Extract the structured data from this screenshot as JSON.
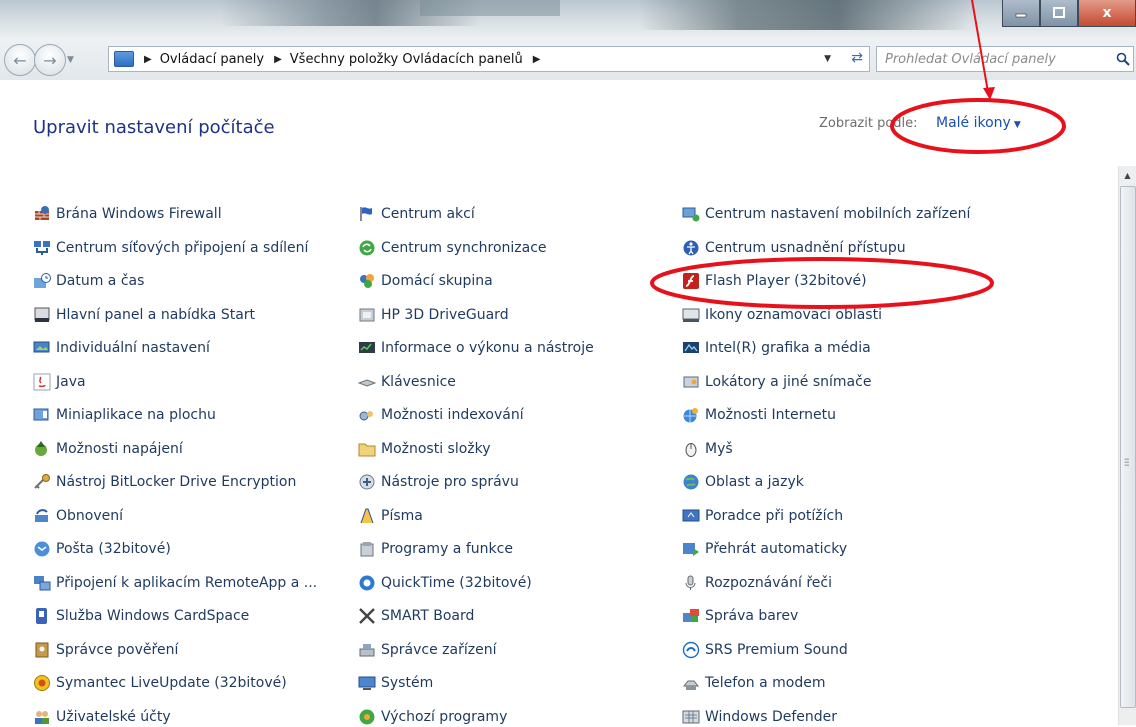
{
  "colors": {
    "link": "#1e3a5f",
    "title": "#1e3287",
    "annotation": "#e8101a"
  },
  "window": {
    "buttons": [
      "minimize-icon",
      "maximize-icon",
      "close-icon"
    ],
    "close_glyph": "x"
  },
  "address": {
    "crumbs": [
      "Ovládací panely",
      "Všechny položky Ovládacích panelů"
    ],
    "search_placeholder": "Prohledat Ovládací panely"
  },
  "header": {
    "title": "Upravit nastavení počítače",
    "view_by_label": "Zobrazit podle:",
    "view_by_value": "Malé ikony"
  },
  "columns": [
    [
      {
        "label": "Brána Windows Firewall",
        "icon": "firewall-icon"
      },
      {
        "label": "Centrum síťových připojení a sdílení",
        "icon": "network-icon"
      },
      {
        "label": "Datum a čas",
        "icon": "clock-icon"
      },
      {
        "label": "Hlavní panel a nabídka Start",
        "icon": "taskbar-icon"
      },
      {
        "label": "Individuální nastavení",
        "icon": "personalize-icon"
      },
      {
        "label": "Java",
        "icon": "java-icon"
      },
      {
        "label": "Miniaplikace na plochu",
        "icon": "gadgets-icon"
      },
      {
        "label": "Možnosti napájení",
        "icon": "power-icon"
      },
      {
        "label": "Nástroj BitLocker Drive Encryption",
        "icon": "bitlocker-icon"
      },
      {
        "label": "Obnovení",
        "icon": "recovery-icon"
      },
      {
        "label": "Pošta (32bitové)",
        "icon": "mail-icon"
      },
      {
        "label": "Připojení k aplikacím RemoteApp a ...",
        "icon": "remoteapp-icon"
      },
      {
        "label": "Služba Windows CardSpace",
        "icon": "cardspace-icon"
      },
      {
        "label": "Správce pověření",
        "icon": "credential-icon"
      },
      {
        "label": "Symantec LiveUpdate (32bitové)",
        "icon": "liveupdate-icon"
      },
      {
        "label": "Uživatelské účty",
        "icon": "users-icon"
      }
    ],
    [
      {
        "label": "Centrum akcí",
        "icon": "flag-icon"
      },
      {
        "label": "Centrum synchronizace",
        "icon": "sync-icon"
      },
      {
        "label": "Domácí skupina",
        "icon": "homegroup-icon"
      },
      {
        "label": "HP 3D DriveGuard",
        "icon": "driveguard-icon"
      },
      {
        "label": "Informace o výkonu a nástroje",
        "icon": "performance-icon"
      },
      {
        "label": "Klávesnice",
        "icon": "keyboard-icon"
      },
      {
        "label": "Možnosti indexování",
        "icon": "indexing-icon"
      },
      {
        "label": "Možnosti složky",
        "icon": "folder-options-icon"
      },
      {
        "label": "Nástroje pro správu",
        "icon": "admin-tools-icon"
      },
      {
        "label": "Písma",
        "icon": "fonts-icon"
      },
      {
        "label": "Programy a funkce",
        "icon": "programs-icon"
      },
      {
        "label": "QuickTime (32bitové)",
        "icon": "quicktime-icon"
      },
      {
        "label": "SMART Board",
        "icon": "smartboard-icon"
      },
      {
        "label": "Správce zařízení",
        "icon": "device-manager-icon"
      },
      {
        "label": "Systém",
        "icon": "system-icon"
      },
      {
        "label": "Výchozí programy",
        "icon": "default-programs-icon"
      }
    ],
    [
      {
        "label": "Centrum nastavení mobilních zařízení",
        "icon": "mobility-icon"
      },
      {
        "label": "Centrum usnadnění přístupu",
        "icon": "accessibility-icon"
      },
      {
        "label": "Flash Player (32bitové)",
        "icon": "flash-icon"
      },
      {
        "label": "Ikony oznamovací oblasti",
        "icon": "notification-icon"
      },
      {
        "label": "Intel(R) grafika a média",
        "icon": "intel-graphics-icon"
      },
      {
        "label": "Lokátory a jiné snímače",
        "icon": "sensors-icon"
      },
      {
        "label": "Možnosti Internetu",
        "icon": "internet-options-icon"
      },
      {
        "label": "Myš",
        "icon": "mouse-icon"
      },
      {
        "label": "Oblast a jazyk",
        "icon": "region-icon"
      },
      {
        "label": "Poradce při potížích",
        "icon": "troubleshoot-icon"
      },
      {
        "label": "Přehrát automaticky",
        "icon": "autoplay-icon"
      },
      {
        "label": "Rozpoznávání řeči",
        "icon": "speech-icon"
      },
      {
        "label": "Správa barev",
        "icon": "color-management-icon"
      },
      {
        "label": "SRS Premium Sound",
        "icon": "srs-icon"
      },
      {
        "label": "Telefon a modem",
        "icon": "phone-modem-icon"
      },
      {
        "label": "Windows Defender",
        "icon": "defender-icon"
      }
    ]
  ]
}
